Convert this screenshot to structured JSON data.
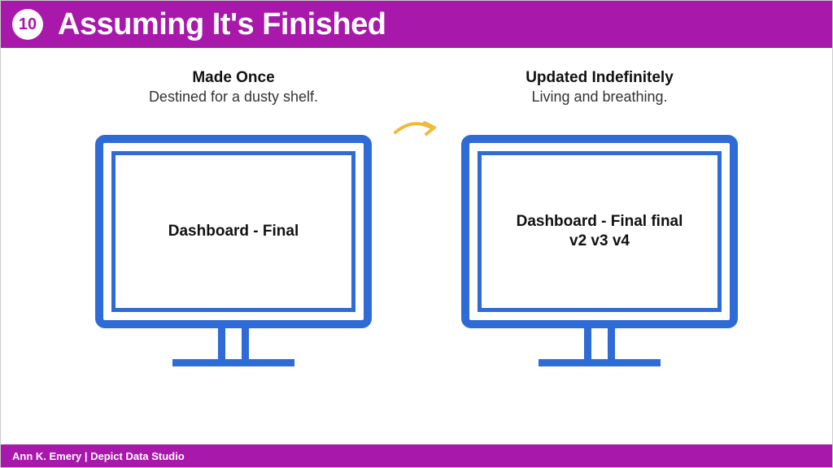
{
  "header": {
    "number": "10",
    "title": "Assuming It's Finished"
  },
  "left": {
    "title": "Made Once",
    "subtitle": "Destined for a dusty shelf.",
    "screen_line1": "Dashboard - Final",
    "screen_line2": ""
  },
  "right": {
    "title": "Updated Indefinitely",
    "subtitle": "Living and breathing.",
    "screen_line1": "Dashboard - Final final",
    "screen_line2": "v2 v3 v4"
  },
  "footer": "Ann K. Emery  |  Depict Data Studio",
  "colors": {
    "brand": "#a818ab",
    "monitor": "#2f6bd6",
    "arrow": "#f0b93a"
  }
}
